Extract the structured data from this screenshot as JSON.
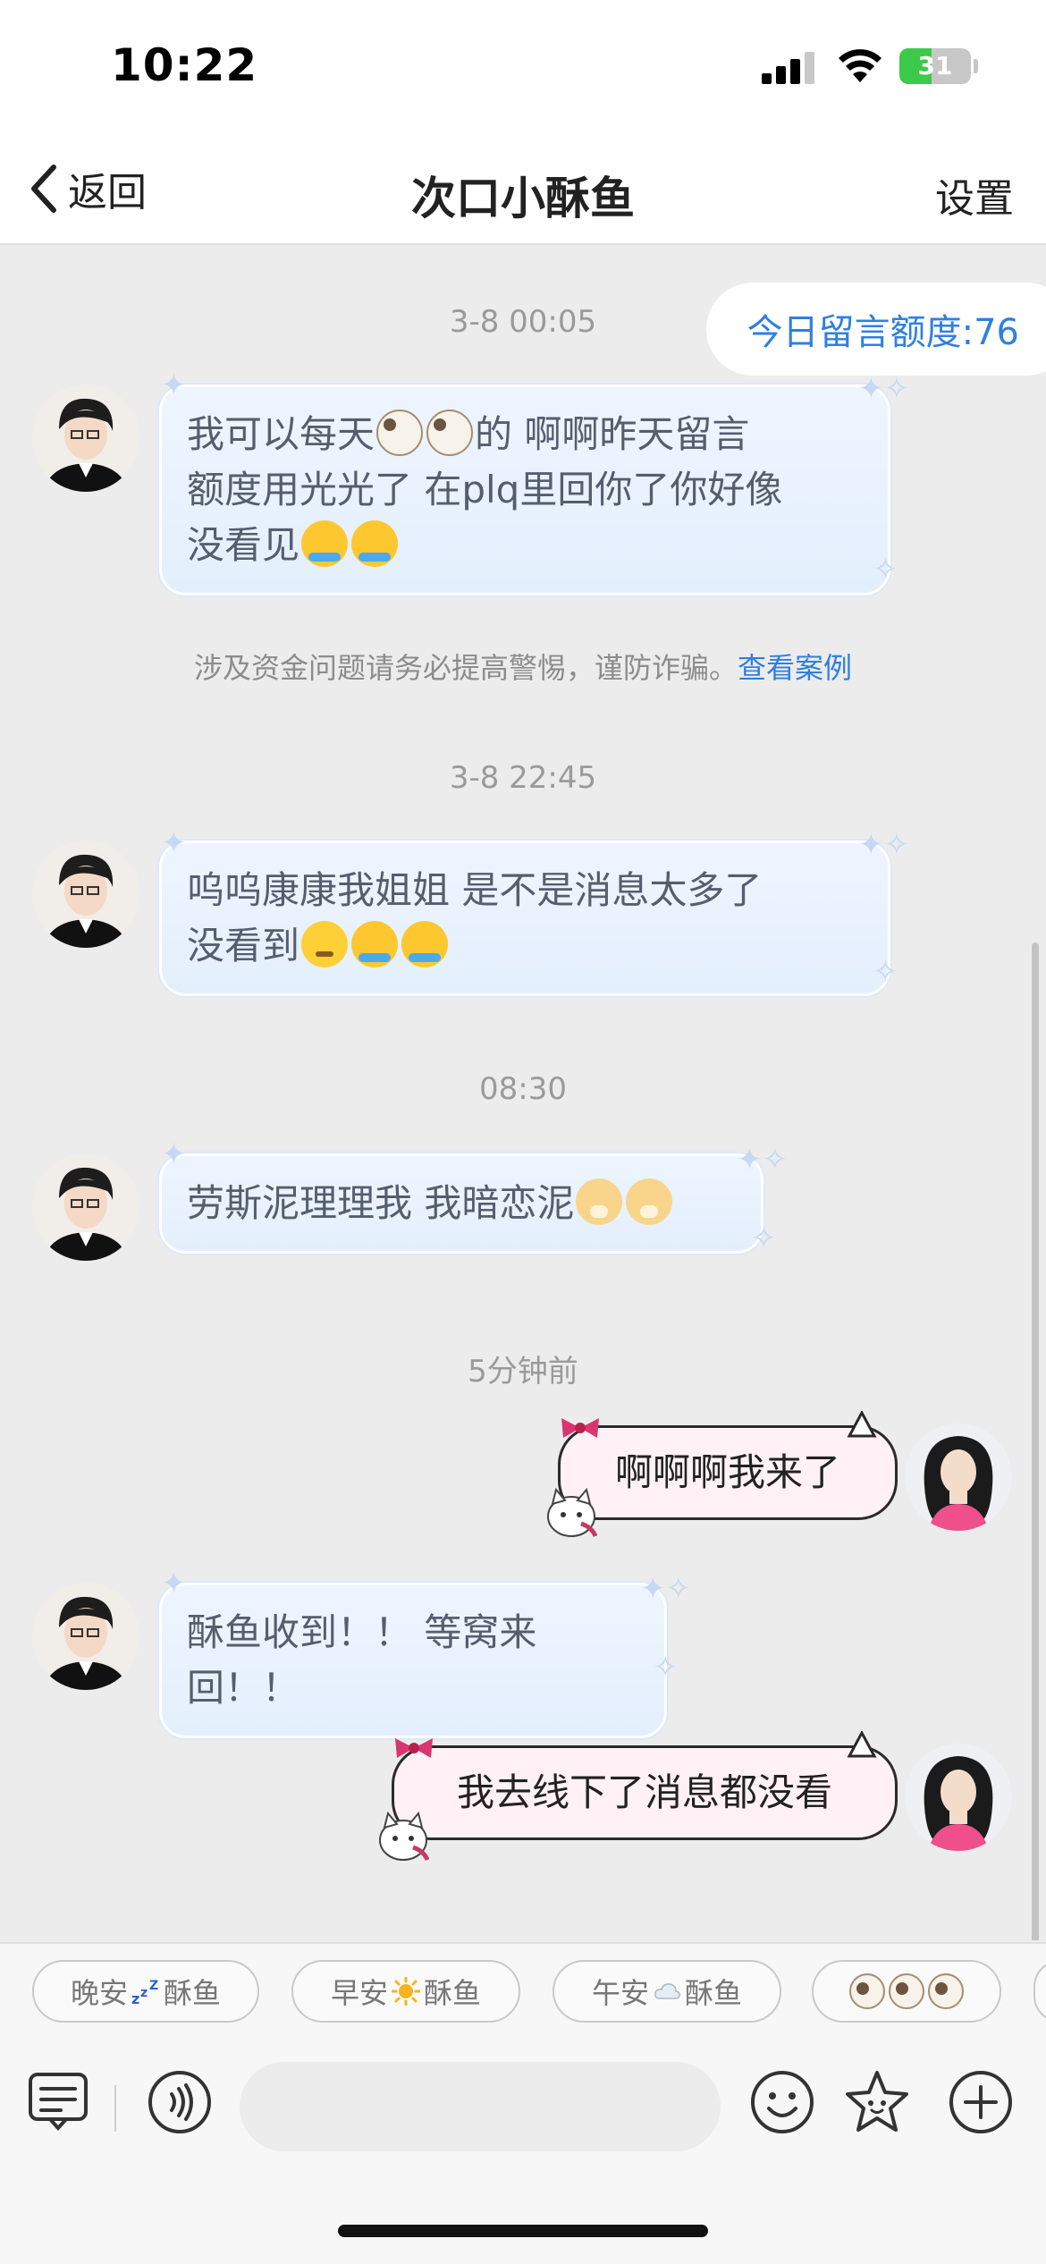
{
  "status_bar": {
    "time": "10:22",
    "battery": "31"
  },
  "nav": {
    "back_label": "返回",
    "title": "次口小酥鱼",
    "settings_label": "设置"
  },
  "quota": {
    "text": "今日留言额度:76"
  },
  "chat": {
    "timestamps": [
      "3-8 00:05",
      "3-8 22:45",
      "08:30",
      "5分钟前"
    ],
    "notice": {
      "text": "涉及资金问题请务必提高警惕，谨防诈骗。",
      "link": "查看案例"
    },
    "messages": [
      {
        "side": "in",
        "line1": "我可以每天",
        "line1b": "的 啊啊昨天留言",
        "line2": "额度用光光了 在plq里回你了你好像",
        "line3": "没看见"
      },
      {
        "side": "in",
        "line1": "呜呜康康我姐姐 是不是消息太多了",
        "line2": "没看到"
      },
      {
        "side": "in",
        "text": "劳斯泥理理我 我暗恋泥"
      },
      {
        "side": "out",
        "text": "啊啊啊我来了"
      },
      {
        "side": "in",
        "text": "酥鱼收到！！ 等窝来回！！"
      },
      {
        "side": "out",
        "text": "我去线下了消息都没看"
      }
    ]
  },
  "quick_replies": [
    {
      "left": "晚安",
      "right": "酥鱼",
      "icon": "zzz-icon"
    },
    {
      "left": "早安",
      "right": "酥鱼",
      "icon": "sun-icon"
    },
    {
      "left": "午安",
      "right": "酥鱼",
      "icon": "cloud-icon"
    },
    {
      "left": "",
      "right": "",
      "icon": "sheep-icon"
    }
  ],
  "input": {
    "value": "",
    "placeholder": ""
  },
  "colors": {
    "accent": "#2f7fe0",
    "incoming_bubble": "#eaf2fd",
    "outgoing_bubble": "#fff1f5"
  }
}
